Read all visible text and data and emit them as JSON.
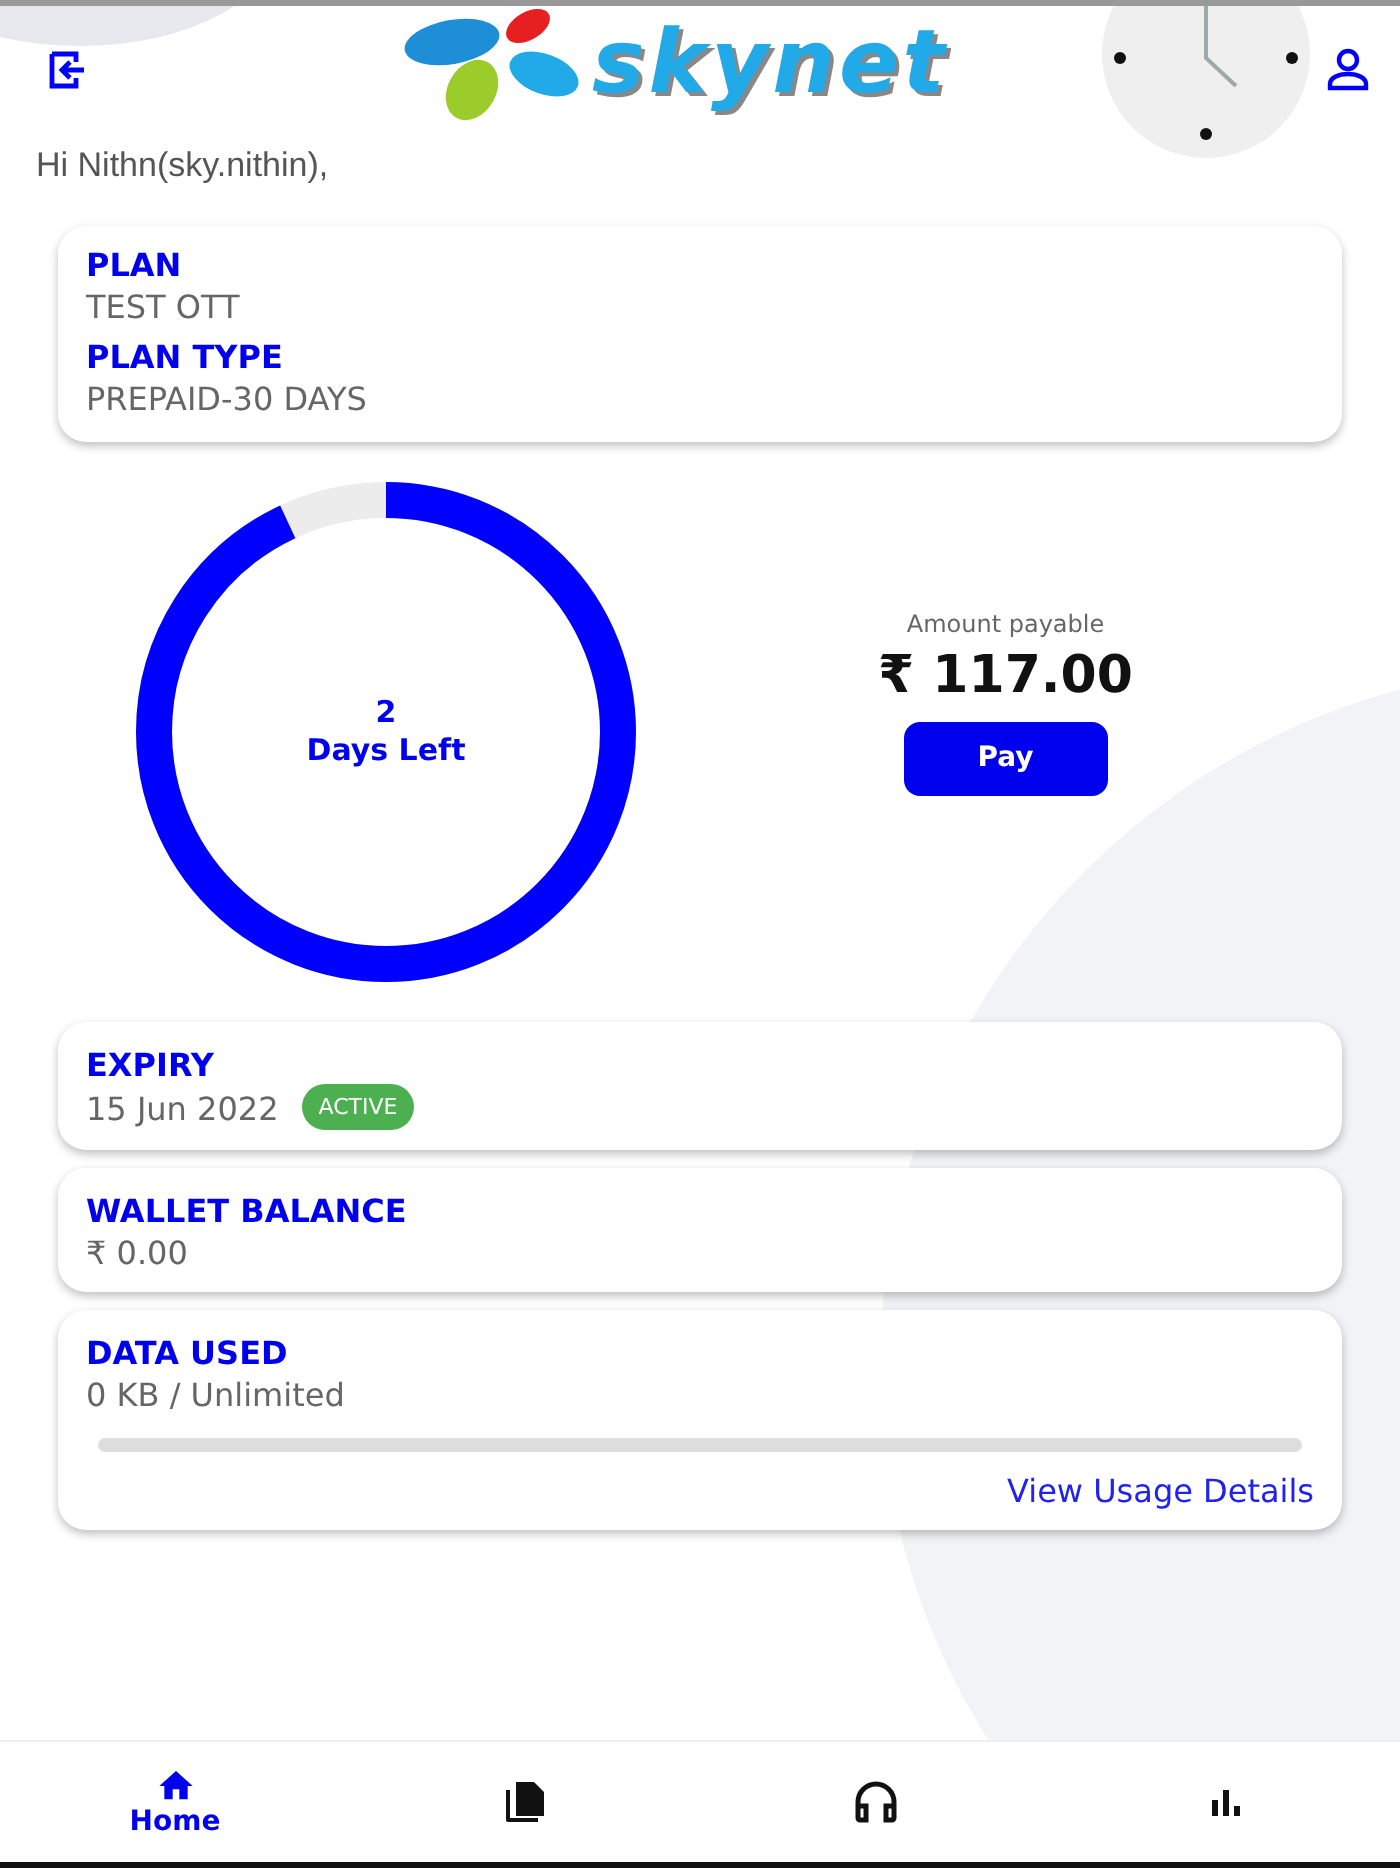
{
  "header": {
    "logo_text": "skynet",
    "greeting": "Hi Nithn(sky.nithin),"
  },
  "plan_card": {
    "fields": [
      {
        "label": "PLAN",
        "value": "TEST OTT"
      },
      {
        "label": "PLAN TYPE",
        "value": "PREPAID-30 DAYS"
      }
    ]
  },
  "days_ring": {
    "level": 0.93,
    "count": "2",
    "caption": "Days Left"
  },
  "payment": {
    "label": "Amount payable",
    "amount": "₹ 117.00",
    "button": "Pay"
  },
  "expiry_card": {
    "label": "EXPIRY",
    "value": "15 Jun 2022",
    "badge": "ACTIVE"
  },
  "wallet_card": {
    "label": "WALLET BALANCE",
    "value": "₹ 0.00"
  },
  "data_card": {
    "label": "DATA USED",
    "value": "0 KB / Unlimited",
    "level": 0,
    "link": "View Usage Details"
  },
  "bottom_nav": [
    {
      "kind": "home",
      "label": "Home",
      "selected": true
    },
    {
      "kind": "documents",
      "selected": false
    },
    {
      "kind": "support",
      "selected": false
    },
    {
      "kind": "stats",
      "selected": false
    }
  ]
}
